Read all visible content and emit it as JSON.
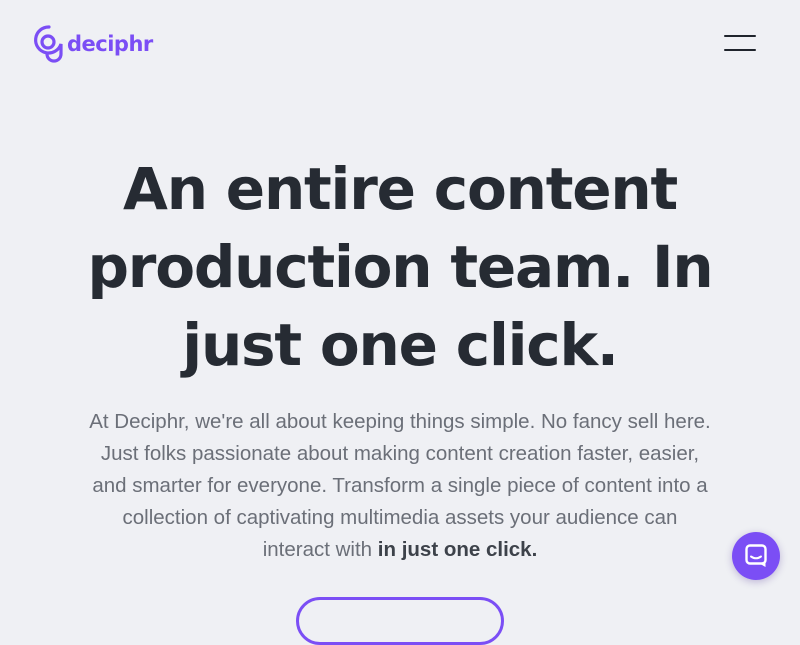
{
  "header": {
    "logo_text": "deciphr",
    "logo_icon": "deciphr-logo-icon",
    "menu_icon": "hamburger-menu-icon"
  },
  "hero": {
    "title": "An entire content production team. In just one click.",
    "description": "At Deciphr, we're all about keeping things simple. No fancy sell here. Just folks passionate about making content creation faster, easier, and smarter for everyone. Transform a single piece of content into a collection of captivating multimedia assets your audience can interact with ",
    "description_emphasis": "in just one click."
  },
  "chat": {
    "icon": "chat-icon"
  },
  "colors": {
    "brand": "#7b4ef5",
    "background": "#eff0f4",
    "heading": "#262b33",
    "body_text": "#6b6f78"
  }
}
